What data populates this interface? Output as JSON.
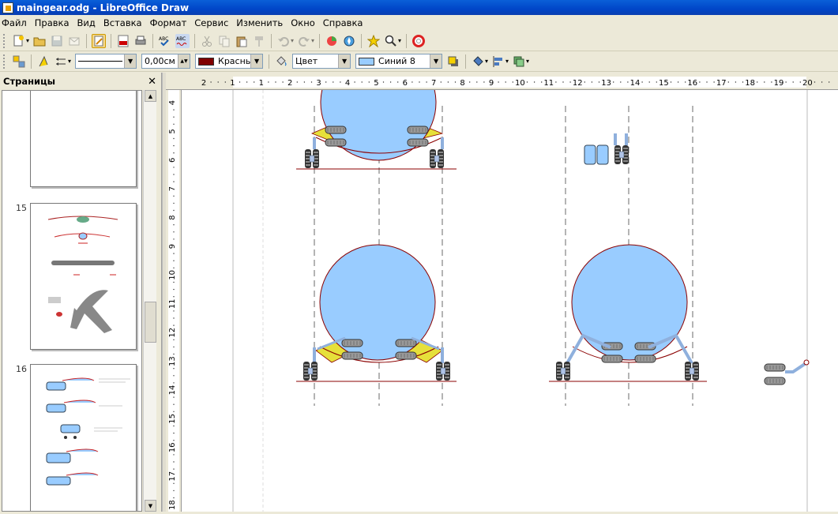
{
  "window": {
    "title": "maingear.odg - LibreOffice Draw"
  },
  "menu": [
    "Файл",
    "Правка",
    "Вид",
    "Вставка",
    "Формат",
    "Сервис",
    "Изменить",
    "Окно",
    "Справка"
  ],
  "toolbar_standard": {
    "icons": [
      "new-icon",
      "open-icon",
      "save-icon",
      "email-icon",
      "edit-file-icon",
      "export-pdf-icon",
      "print-icon",
      "spellcheck-icon",
      "autospellcheck-icon",
      "cut-icon",
      "copy-icon",
      "paste-icon",
      "clone-format-icon",
      "undo-icon",
      "redo-icon",
      "chart-icon",
      "navigator-icon",
      "gallery-star-icon",
      "zoom-icon",
      "help-icon"
    ]
  },
  "toolbar_line_fill": {
    "line_width": "0,00см",
    "line_color_label": "Красный",
    "line_color": "#800000",
    "area_style": "Цвет",
    "fill_color_label": "Синий 8",
    "fill_color": "#99ccff"
  },
  "side_panel": {
    "title": "Страницы",
    "close_label": "✕",
    "pages": [
      {
        "number": ""
      },
      {
        "number": "15"
      },
      {
        "number": "16"
      }
    ]
  },
  "ruler_h": [
    "2",
    "1",
    "1",
    "2",
    "3",
    "4",
    "5",
    "6",
    "7",
    "8",
    "9",
    "10",
    "11",
    "12",
    "13",
    "14",
    "15",
    "16",
    "17",
    "18",
    "19",
    "20"
  ],
  "ruler_v": [
    "4",
    "5",
    "6",
    "7",
    "8",
    "9",
    "10",
    "11",
    "12",
    "13",
    "14",
    "15",
    "16",
    "17",
    "18"
  ],
  "colors": {
    "fuselage": "#99ccff",
    "outline": "#8b0000",
    "fairing": "#e6e03a",
    "strut": "#8fb0dd"
  }
}
